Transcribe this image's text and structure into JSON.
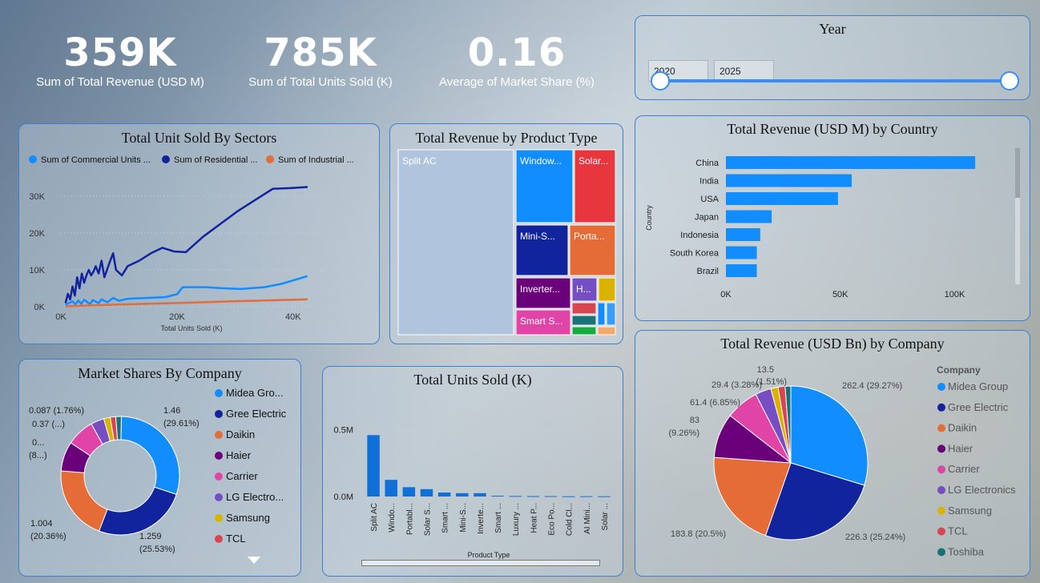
{
  "kpis": [
    {
      "value": "359K",
      "label": "Sum of Total Revenue (USD M)"
    },
    {
      "value": "785K",
      "label": "Sum of Total Units Sold (K)"
    },
    {
      "value": "0.16",
      "label": "Average of Market Share (%)"
    }
  ],
  "year_filter": {
    "title": "Year",
    "from": "2020",
    "to": "2025"
  },
  "colors": {
    "light_blue": "#118dff",
    "dark_blue": "#12239e",
    "orange": "#e66c37",
    "purple": "#6b007b",
    "pink": "#e044a7",
    "violet": "#744ec2",
    "yellow": "#d9b300",
    "red": "#d64550",
    "teal": "#197278",
    "panel_border": "#3f7fd0"
  },
  "chart_data": [
    {
      "id": "unit_sold_by_sectors",
      "type": "line",
      "title": "Total Unit Sold By Sectors",
      "xlabel": "Total Units Sold (K)",
      "ylabel": "",
      "xlim": [
        0,
        45000
      ],
      "ylim": [
        0,
        35000
      ],
      "x_ticks": [
        "0K",
        "20K",
        "40K"
      ],
      "y_ticks": [
        "0K",
        "10K",
        "20K",
        "30K"
      ],
      "legend": [
        {
          "label": "Sum of Commercial Units ...",
          "color": "#118dff"
        },
        {
          "label": "Sum of Residential ...",
          "color": "#12239e"
        },
        {
          "label": "Sum of Industrial ...",
          "color": "#e66c37"
        }
      ],
      "series": [
        {
          "name": "Sum of Commercial Units ...",
          "color": "#118dff",
          "x": [
            800,
            2000,
            2500,
            3000,
            3500,
            4000,
            5000,
            5500,
            6500,
            7000,
            8000,
            9000,
            10000,
            11000,
            12000,
            15000,
            18000,
            20000,
            21000,
            25000,
            28000,
            31000,
            35000,
            38000,
            42500
          ],
          "y": [
            500,
            1500,
            600,
            1700,
            800,
            1900,
            700,
            1800,
            1000,
            2000,
            1200,
            2400,
            1600,
            2000,
            2200,
            2400,
            2600,
            3400,
            5300,
            5300,
            5000,
            4800,
            5300,
            6200,
            8300
          ]
        },
        {
          "name": "Sum of Residential ...",
          "color": "#12239e",
          "x": [
            800,
            1200,
            1600,
            2000,
            2400,
            2800,
            3200,
            3600,
            4000,
            4400,
            4800,
            5200,
            5600,
            6000,
            6500,
            7000,
            7500,
            8500,
            9000,
            9500,
            10500,
            11500,
            13500,
            15500,
            17500,
            19500,
            21500,
            24500,
            27500,
            30500,
            33500,
            36500,
            39500,
            42500
          ],
          "y": [
            1000,
            3500,
            2000,
            5500,
            3000,
            8000,
            5000,
            9000,
            6500,
            8500,
            10000,
            8500,
            9500,
            11000,
            9000,
            12500,
            8000,
            12500,
            14500,
            10000,
            8500,
            11000,
            12500,
            14500,
            16000,
            15000,
            14800,
            19000,
            22500,
            26000,
            29000,
            32000,
            32200,
            32500
          ]
        },
        {
          "name": "Sum of Industrial ...",
          "color": "#e66c37",
          "x": [
            800,
            10000,
            20000,
            30000,
            42500
          ],
          "y": [
            100,
            600,
            1000,
            1500,
            2000
          ]
        }
      ]
    },
    {
      "id": "revenue_by_product_type",
      "type": "treemap",
      "title": "Total Revenue by Product Type",
      "items": [
        {
          "label": "Split AC",
          "color": "#b0c4de"
        },
        {
          "label": "Window...",
          "color": "#118dff"
        },
        {
          "label": "Solar...",
          "color": "#e8363f"
        },
        {
          "label": "Mini-S...",
          "color": "#12239e"
        },
        {
          "label": "Porta...",
          "color": "#e66c37"
        },
        {
          "label": "Inverter...",
          "color": "#6b007b"
        },
        {
          "label": "H...",
          "color": "#744ec2"
        },
        {
          "label": "",
          "color": "#d9b300"
        },
        {
          "label": "Smart S...",
          "color": "#e044a7"
        },
        {
          "label": "",
          "color": "#d64550"
        },
        {
          "label": "",
          "color": "#118dff"
        },
        {
          "label": "",
          "color": "#197278"
        },
        {
          "label": "",
          "color": "#1aab40"
        },
        {
          "label": "",
          "color": "#f5a86b"
        },
        {
          "label": "",
          "color": "#3b9bff"
        }
      ]
    },
    {
      "id": "revenue_by_country",
      "type": "bar",
      "orientation": "horizontal",
      "title": "Total Revenue (USD M) by Country",
      "ylabel": "Country",
      "xlim": [
        0,
        110000
      ],
      "x_ticks": [
        "0K",
        "50K",
        "100K"
      ],
      "categories": [
        "China",
        "India",
        "USA",
        "Japan",
        "Indonesia",
        "South Korea",
        "Brazil"
      ],
      "values": [
        109000,
        55000,
        49000,
        20000,
        15000,
        13500,
        13500
      ],
      "color": "#118dff"
    },
    {
      "id": "market_shares_by_company",
      "type": "pie",
      "variant": "donut",
      "title": "Market Shares By Company",
      "slices": [
        {
          "label": "Midea Gro...",
          "value": 29.61,
          "data_label": "1.46",
          "pct_label": "(29.61%)",
          "color": "#118dff"
        },
        {
          "label": "Gree Electric",
          "value": 25.53,
          "data_label": "1.259",
          "pct_label": "(25.53%)",
          "color": "#12239e"
        },
        {
          "label": "Daikin",
          "value": 20.36,
          "data_label": "1.004",
          "pct_label": "(20.36%)",
          "color": "#e66c37"
        },
        {
          "label": "Haier",
          "value": 8.0,
          "data_label": "0...",
          "pct_label": "(8...)",
          "color": "#6b007b"
        },
        {
          "label": "Carrier",
          "value": 7.5,
          "data_label": "",
          "pct_label": "",
          "color": "#e044a7"
        },
        {
          "label": "LG Electro...",
          "value": 3.6,
          "data_label": "0.37 (...)",
          "pct_label": "",
          "color": "#744ec2"
        },
        {
          "label": "Samsung",
          "value": 1.76,
          "data_label": "0.087 (1.76%)",
          "pct_label": "",
          "color": "#d9b300"
        },
        {
          "label": "TCL",
          "value": 1.5,
          "data_label": "",
          "pct_label": "",
          "color": "#d64550"
        },
        {
          "label": "",
          "value": 1.5,
          "data_label": "",
          "pct_label": "",
          "color": "#197278"
        }
      ]
    },
    {
      "id": "total_units_sold",
      "type": "bar",
      "title": "Total Units Sold (K)",
      "xlabel": "Product Type",
      "ylim": [
        0,
        600000
      ],
      "y_ticks": [
        "0.0M",
        "0.5M"
      ],
      "categories": [
        "Split AC",
        "Windo...",
        "Portabl...",
        "Solar S...",
        "Smart ...",
        "Mini-S...",
        "Inverte...",
        "Smart ...",
        "Luxury ...",
        "Heat P...",
        "Eco Po...",
        "Cold Cl...",
        "AI Mini...",
        "Solar ..."
      ],
      "values": [
        460000,
        125000,
        70000,
        55000,
        30000,
        25000,
        25000,
        6000,
        4000,
        3000,
        3000,
        2000,
        2000,
        2000
      ],
      "color": "#1170d8"
    },
    {
      "id": "revenue_by_company",
      "type": "pie",
      "title": "Total Revenue (USD Bn) by Company",
      "legend_title": "Company",
      "slices": [
        {
          "label": "Midea Group",
          "value": 262.4,
          "data_label": "262.4 (29.27%)",
          "color": "#118dff"
        },
        {
          "label": "Gree Electric",
          "value": 226.3,
          "data_label": "226.3 (25.24%)",
          "color": "#12239e"
        },
        {
          "label": "Daikin",
          "value": 183.8,
          "data_label": "183.8 (20.5%)",
          "color": "#e66c37"
        },
        {
          "label": "Haier",
          "value": 83,
          "data_label": "83",
          "data_label2": "(9.26%)",
          "color": "#6b007b"
        },
        {
          "label": "Carrier",
          "value": 61.4,
          "data_label": "61.4 (6.85%)",
          "color": "#e044a7"
        },
        {
          "label": "LG Electronics",
          "value": 29.4,
          "data_label": "29.4 (3.28%)",
          "color": "#744ec2"
        },
        {
          "label": "Samsung",
          "value": 13.5,
          "data_label": "13.5",
          "data_label2": "(1.51%)",
          "color": "#d9b300"
        },
        {
          "label": "TCL",
          "value": 13.0,
          "data_label": "",
          "color": "#d64550"
        },
        {
          "label": "Toshiba",
          "value": 10.5,
          "data_label": "",
          "color": "#197278"
        }
      ]
    }
  ]
}
